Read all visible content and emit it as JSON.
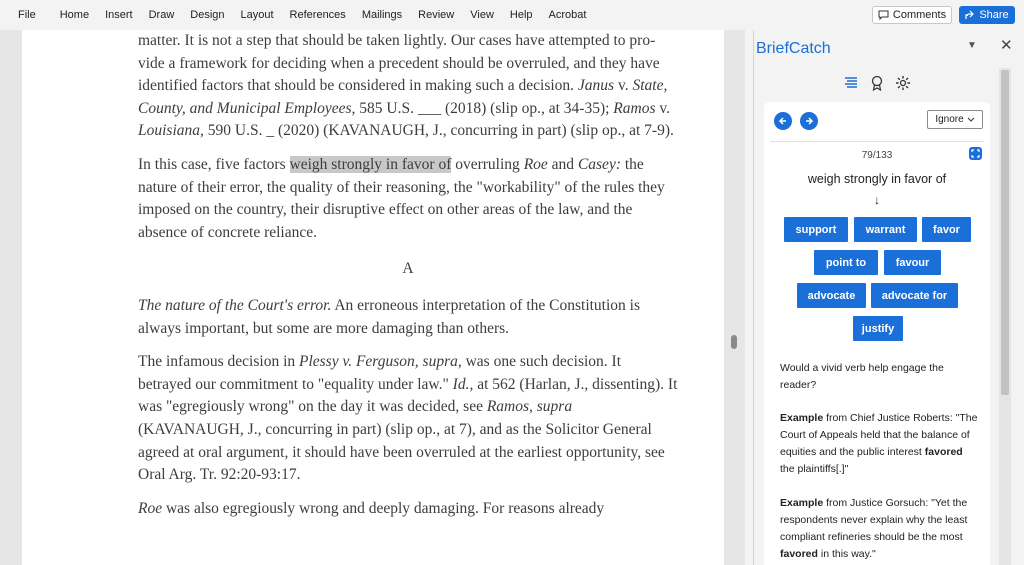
{
  "ribbon": {
    "menus": [
      "File",
      "Home",
      "Insert",
      "Draw",
      "Design",
      "Layout",
      "References",
      "Mailings",
      "Review",
      "View",
      "Help",
      "Acrobat"
    ],
    "comments_label": "Comments",
    "share_label": "Share"
  },
  "document": {
    "p1": {
      "a": "matter. It is not a step that should be taken lightly. Our cases have attempted to pro- vide a framework for deciding when a precedent should be overruled, and they have identified factors that should be considered in making such a decision. ",
      "case1": "Janus",
      "v1": " v. ",
      "case1b": "State, County, and Municipal Employees,",
      "b": " 585 U.S. ___ (2018) (slip op., at 34-35); ",
      "case2": "Ramos",
      "v2": " v. ",
      "case2b": "Louisiana,",
      "c": " 590 U.S. _ (2020) (KAVANAUGH, J., concurring in part) (slip op., at 7-9)."
    },
    "p2": {
      "a": "In this case, five factors ",
      "highlight": "weigh strongly in favor of",
      "b": " overruling ",
      "roe": "Roe",
      "c": " and ",
      "casey": "Casey:",
      "d": " the nature of their error, the quality of their reasoning, the \"workability\" of the rules they imposed on the country, their disruptive effect on other areas of the law, and the absence of concrete reliance."
    },
    "heading": "A",
    "p3": {
      "italic": "The nature of the Court's error.",
      "a": " An erroneous interpretation of the Constitution is always important, but some are more damaging than others."
    },
    "p4": {
      "a": "The infamous decision in ",
      "plessy": "Plessy v. Ferguson, supra,",
      "b": " was one such decision. It betrayed our commitment to \"equality under law.\" ",
      "id": "Id.,",
      "c": " at 562 (Harlan, J., dissenting). It was \"egregiously wrong\" on the day it was decided, see ",
      "ramos": "Ramos, supra",
      "d": " (KAVANAUGH, J., concurring in part) (slip op., at 7), and as the Solicitor General agreed at oral argument, it should have been overruled at the earliest opportunity, see Oral Arg. Tr. 92:20-93:17."
    },
    "p5": {
      "roe": "Roe",
      "a": " was also egregiously wrong and deeply damaging. For reasons already"
    }
  },
  "panel": {
    "title": "BriefCatch",
    "ignore_label": "Ignore",
    "counter": "79/133",
    "phrase": "weigh strongly in favor of",
    "arrow": "↓",
    "suggestions": [
      "support",
      "warrant",
      "favor",
      "point to",
      "favour",
      "advocate",
      "advocate for",
      "justify"
    ],
    "question": "Would a vivid verb help engage the reader?",
    "example1": {
      "label": "Example",
      "source": " from Chief Justice Roberts: \"The Court of Appeals held that the balance of equities and the public interest ",
      "bold": "favored",
      "end": " the plaintiffs[.]\""
    },
    "example2": {
      "label": "Example",
      "source": " from Justice Gorsuch: \"Yet the respondents never explain why the least compliant refineries should be the most ",
      "bold": "favored",
      "end": " in this way.\""
    }
  },
  "colors": {
    "accent": "#1a6fd8",
    "highlight": "#c8c8c8"
  }
}
